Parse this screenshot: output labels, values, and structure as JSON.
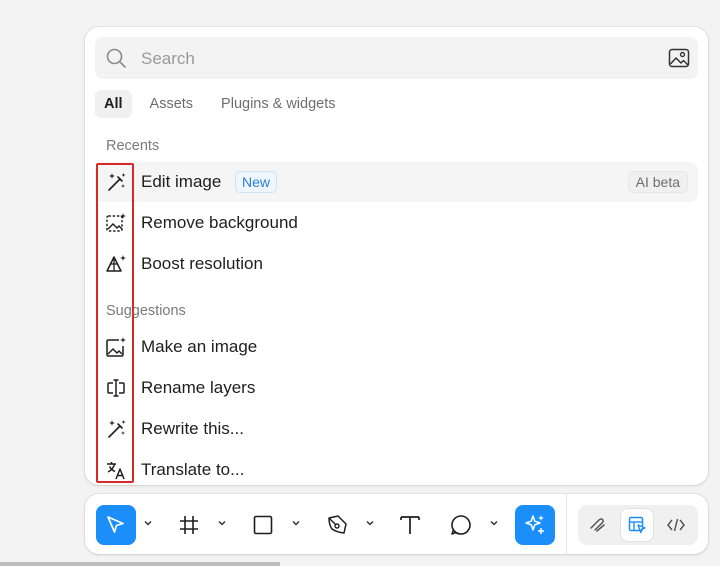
{
  "search": {
    "placeholder": "Search",
    "icon": "search-icon",
    "image_button_icon": "image-search-icon"
  },
  "tabs": [
    {
      "label": "All",
      "active": true
    },
    {
      "label": "Assets",
      "active": false
    },
    {
      "label": "Plugins & widgets",
      "active": false
    }
  ],
  "recents": {
    "label": "Recents",
    "items": [
      {
        "label": "Edit image",
        "icon": "magic-wand-icon",
        "badge": "New",
        "tag": "AI beta"
      },
      {
        "label": "Remove background",
        "icon": "remove-background-icon"
      },
      {
        "label": "Boost resolution",
        "icon": "boost-resolution-icon"
      }
    ]
  },
  "suggestions": {
    "label": "Suggestions",
    "items": [
      {
        "label": "Make an image",
        "icon": "image-sparkle-icon"
      },
      {
        "label": "Rename layers",
        "icon": "rename-layers-icon"
      },
      {
        "label": "Rewrite this...",
        "icon": "magic-wand-icon"
      },
      {
        "label": "Translate to...",
        "icon": "translate-icon"
      }
    ]
  },
  "toolbar": {
    "tools": [
      {
        "name": "move-tool",
        "icon": "cursor-icon",
        "active": true
      },
      {
        "name": "frame-tool",
        "icon": "frame-icon"
      },
      {
        "name": "rectangle-tool",
        "icon": "rectangle-icon"
      },
      {
        "name": "pen-tool",
        "icon": "pen-icon"
      },
      {
        "name": "text-tool",
        "icon": "text-icon"
      },
      {
        "name": "comment-tool",
        "icon": "comment-icon"
      },
      {
        "name": "ai-actions",
        "icon": "sparkle-icon",
        "active": true
      }
    ],
    "modes": [
      {
        "name": "draw-mode",
        "icon": "draw-icon"
      },
      {
        "name": "design-mode",
        "icon": "design-mode-icon",
        "selected": true
      },
      {
        "name": "dev-mode",
        "icon": "code-icon"
      }
    ]
  },
  "colors": {
    "accent": "#1c8ef9",
    "highlight_box": "#d42a2a",
    "badge_new_text": "#2a7fd4"
  }
}
